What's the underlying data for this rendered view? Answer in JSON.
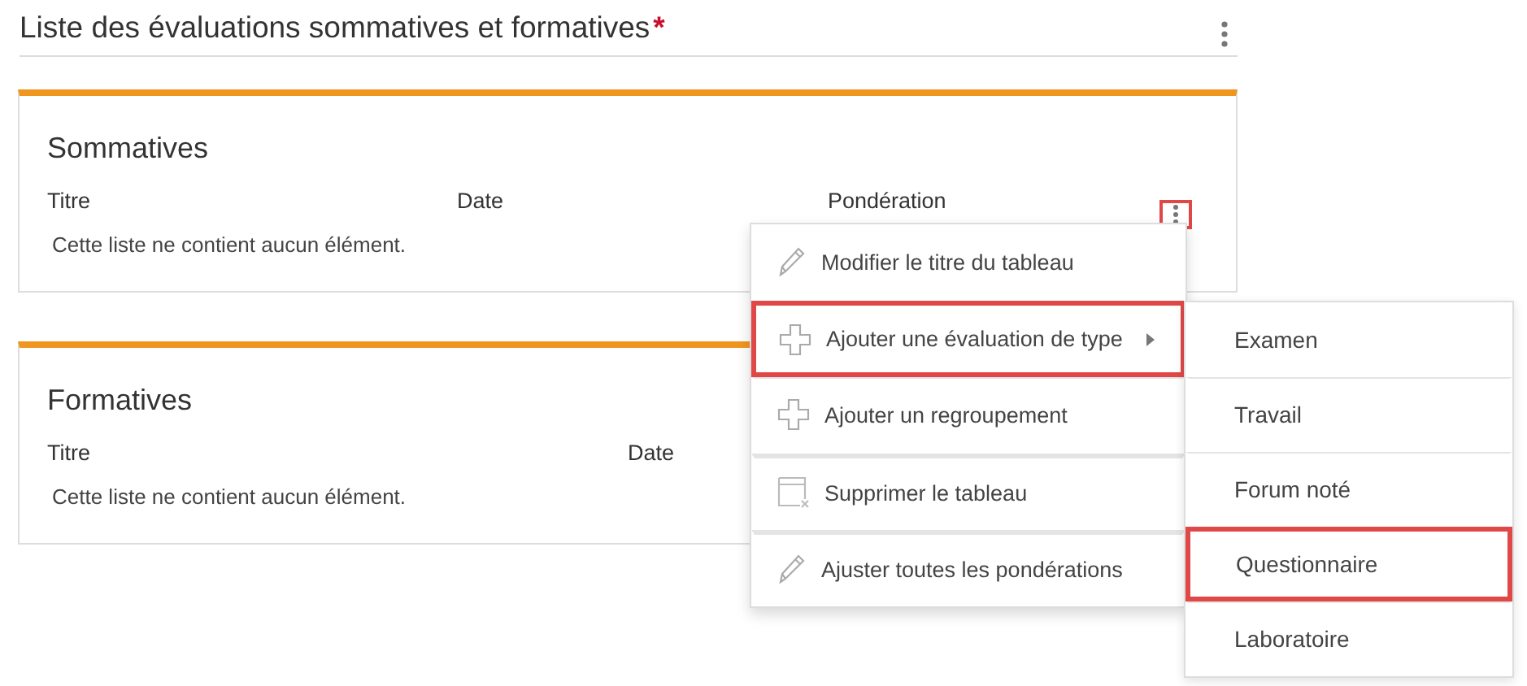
{
  "header": {
    "title": "Liste des évaluations sommatives et formatives",
    "required_mark": "*"
  },
  "sections": [
    {
      "title": "Sommatives",
      "columns": [
        "Titre",
        "Date",
        "Pondération"
      ],
      "empty_message": "Cette liste ne contient aucun élément.",
      "menu_highlighted": true
    },
    {
      "title": "Formatives",
      "columns": [
        "Titre",
        "Date"
      ],
      "empty_message": "Cette liste ne contient aucun élément."
    }
  ],
  "context_menu": {
    "items": [
      {
        "label": "Modifier le titre du tableau",
        "has_submenu": false,
        "highlighted": false
      },
      {
        "label": "Ajouter une évaluation de type",
        "has_submenu": true,
        "highlighted": true
      },
      {
        "label": "Ajouter un regroupement",
        "has_submenu": false,
        "highlighted": false
      },
      {
        "label": "Supprimer le tableau",
        "has_submenu": false,
        "highlighted": false
      },
      {
        "label": "Ajuster toutes les pondérations",
        "has_submenu": false,
        "highlighted": false
      }
    ]
  },
  "submenu": {
    "items": [
      {
        "label": "Examen",
        "highlighted": false
      },
      {
        "label": "Travail",
        "highlighted": false
      },
      {
        "label": "Forum noté",
        "highlighted": false
      },
      {
        "label": "Questionnaire",
        "highlighted": true
      },
      {
        "label": "Laboratoire",
        "highlighted": false
      }
    ]
  }
}
